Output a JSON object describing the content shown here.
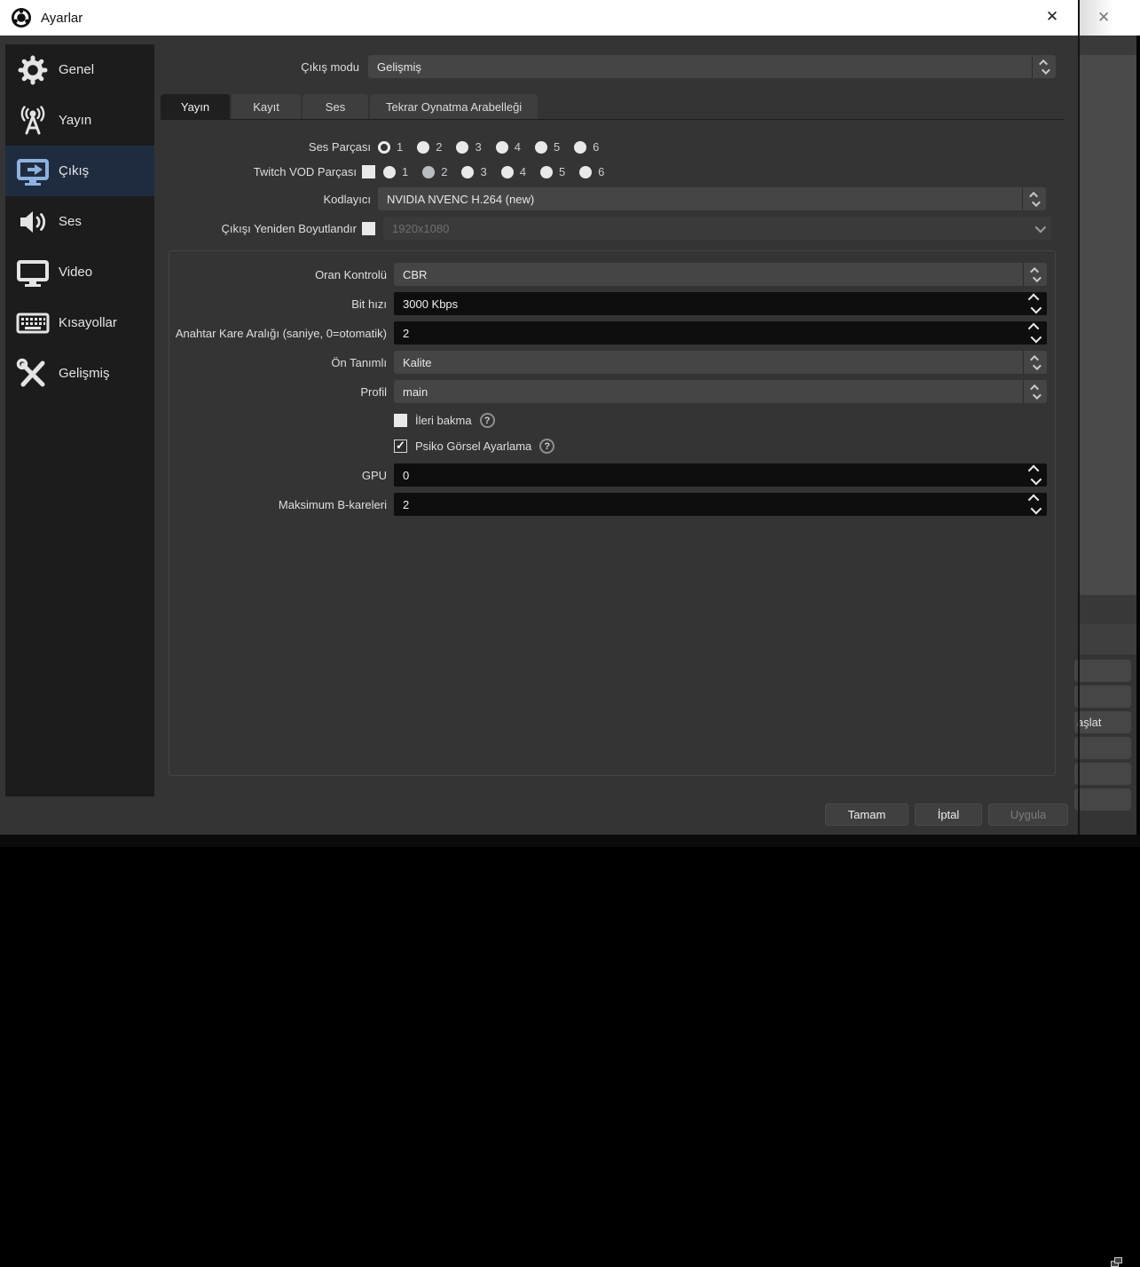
{
  "window": {
    "title": "Ayarlar",
    "close_glyph": "✕"
  },
  "colors": {
    "titlebar_bg": "#ffffff",
    "dialog_bg": "#343434",
    "sidebar_bg": "#1c1c1c",
    "sidebar_selected_bg": "#1f2c40",
    "selected_icon_blue": "#8fb2dd",
    "field_bg": "#454545",
    "spinbox_bg": "#0e0e0e",
    "tab_active_bg": "#1f1f1f"
  },
  "sidebar": {
    "items": [
      {
        "label": "Genel",
        "icon": "gear",
        "selected": false
      },
      {
        "label": "Yayın",
        "icon": "broadcast",
        "selected": false
      },
      {
        "label": "Çıkış",
        "icon": "output",
        "selected": true
      },
      {
        "label": "Ses",
        "icon": "speaker",
        "selected": false
      },
      {
        "label": "Video",
        "icon": "monitor",
        "selected": false
      },
      {
        "label": "Kısayollar",
        "icon": "keyboard",
        "selected": false
      },
      {
        "label": "Gelişmiş",
        "icon": "tools",
        "selected": false
      }
    ]
  },
  "output_mode": {
    "label": "Çıkış modu",
    "value": "Gelişmiş"
  },
  "tabs": [
    {
      "label": "Yayın",
      "active": true
    },
    {
      "label": "Kayıt",
      "active": false
    },
    {
      "label": "Ses",
      "active": false
    },
    {
      "label": "Tekrar Oynatma Arabelleği",
      "active": false
    }
  ],
  "stream_tab": {
    "audio_track": {
      "label": "Ses Parçası",
      "options": [
        {
          "n": "1",
          "selected": true
        },
        {
          "n": "2",
          "selected": false
        },
        {
          "n": "3",
          "selected": false
        },
        {
          "n": "4",
          "selected": false
        },
        {
          "n": "5",
          "selected": false
        },
        {
          "n": "6",
          "selected": false
        }
      ]
    },
    "twitch_vod": {
      "label": "Twitch VOD Parçası",
      "checked": false,
      "options": [
        {
          "n": "1",
          "selected": false
        },
        {
          "n": "2",
          "selected": true
        },
        {
          "n": "3",
          "selected": false
        },
        {
          "n": "4",
          "selected": false
        },
        {
          "n": "5",
          "selected": false
        },
        {
          "n": "6",
          "selected": false
        }
      ]
    },
    "encoder": {
      "label": "Kodlayıcı",
      "value": "NVIDIA NVENC H.264 (new)"
    },
    "rescale": {
      "label": "Çıkışı Yeniden Boyutlandır",
      "checked": false,
      "value": "1920x1080",
      "disabled": true
    },
    "encoder_settings": {
      "rate_control": {
        "label": "Oran Kontrolü",
        "value": "CBR"
      },
      "bitrate": {
        "label": "Bit hızı",
        "value": "3000 Kbps"
      },
      "keyframe_interval": {
        "label": "Anahtar Kare Aralığı (saniye, 0=otomatik)",
        "value": "2"
      },
      "preset": {
        "label": "Ön Tanımlı",
        "value": "Kalite"
      },
      "profile": {
        "label": "Profil",
        "value": "main"
      },
      "lookahead": {
        "label": "İleri bakma",
        "checked": false,
        "help_glyph": "?"
      },
      "psycho_visual": {
        "label": "Psiko Görsel Ayarlama",
        "checked": true,
        "help_glyph": "?"
      },
      "gpu": {
        "label": "GPU",
        "value": "0"
      },
      "max_bframes": {
        "label": "Maksimum B-kareleri",
        "value": "2"
      }
    }
  },
  "footer": {
    "ok": "Tamam",
    "cancel": "İptal",
    "apply": "Uygula",
    "apply_disabled": true
  },
  "background_window": {
    "close_glyph": "✕",
    "partial_button_label": "aşlat"
  }
}
